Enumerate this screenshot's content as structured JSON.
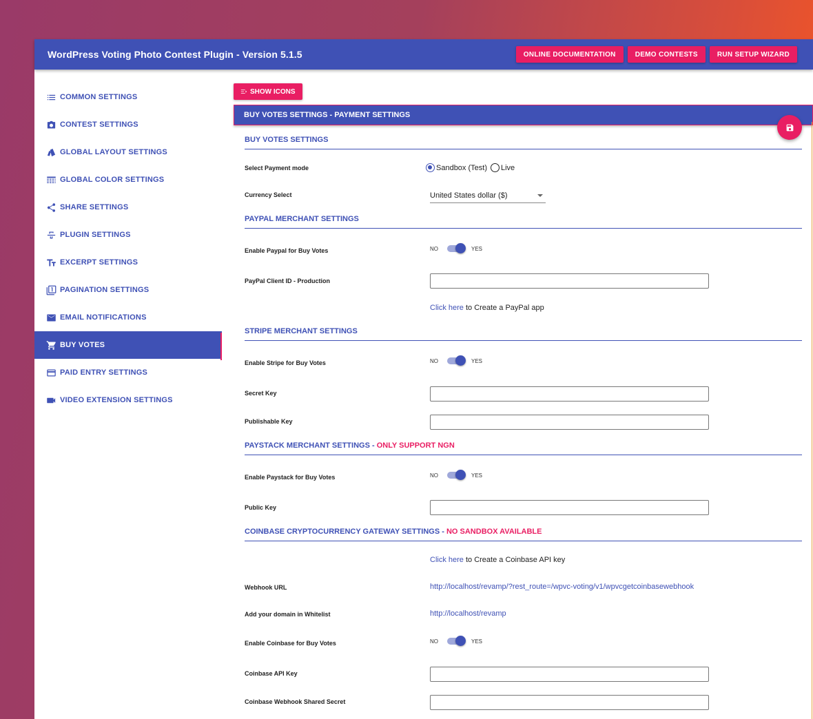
{
  "header": {
    "title": "WordPress Voting Photo Contest Plugin - Version 5.1.5",
    "buttons": [
      "ONLINE DOCUMENTATION",
      "DEMO CONTESTS",
      "RUN SETUP WIZARD"
    ]
  },
  "sidebar": {
    "items": [
      {
        "label": "COMMON SETTINGS",
        "icon": "list-icon"
      },
      {
        "label": "CONTEST SETTINGS",
        "icon": "camera-icon"
      },
      {
        "label": "GLOBAL LAYOUT SETTINGS",
        "icon": "layout-icon"
      },
      {
        "label": "GLOBAL COLOR SETTINGS",
        "icon": "color-grid-icon"
      },
      {
        "label": "SHARE SETTINGS",
        "icon": "share-icon"
      },
      {
        "label": "PLUGIN SETTINGS",
        "icon": "strikethrough-icon"
      },
      {
        "label": "EXCERPT SETTINGS",
        "icon": "text-fields-icon"
      },
      {
        "label": "PAGINATION SETTINGS",
        "icon": "filter-one-icon"
      },
      {
        "label": "EMAIL NOTIFICATIONS",
        "icon": "mail-icon"
      },
      {
        "label": "BUY VOTES",
        "icon": "cart-icon",
        "active": true
      },
      {
        "label": "PAID ENTRY SETTINGS",
        "icon": "card-icon"
      },
      {
        "label": "VIDEO EXTENSION SETTINGS",
        "icon": "video-icon"
      }
    ]
  },
  "main": {
    "show_icons": "SHOW ICONS",
    "banner": "BUY VOTES SETTINGS - PAYMENT SETTINGS",
    "buy_votes": {
      "title": "BUY VOTES SETTINGS",
      "payment_mode_label": "Select Payment mode",
      "sandbox": "Sandbox (Test)",
      "live": "Live",
      "currency_label": "Currency Select",
      "currency_value": "United States dollar ($)"
    },
    "paypal": {
      "title": "PAYPAL MERCHANT SETTINGS",
      "enable_label": "Enable Paypal for Buy Votes",
      "client_id_label": "PayPal Client ID - Production",
      "click_here": "Click here",
      "create_text": " to Create a PayPal app"
    },
    "stripe": {
      "title": "STRIPE MERCHANT SETTINGS",
      "enable_label": "Enable Stripe for Buy Votes",
      "secret_label": "Secret Key",
      "publishable_label": "Publishable Key"
    },
    "paystack": {
      "title": "PAYSTACK MERCHANT SETTINGS - ",
      "warning": "ONLY SUPPORT NGN",
      "enable_label": "Enable Paystack for Buy Votes",
      "public_key_label": "Public Key"
    },
    "coinbase": {
      "title": "COINBASE CRYPTOCURRENCY GATEWAY SETTINGS - ",
      "warning": "NO SANDBOX AVAILABLE",
      "click_here": "Click here",
      "create_text": " to Create a Coinbase API key",
      "webhook_label": "Webhook URL",
      "webhook_url": "http://localhost/revamp/?rest_route=/wpvc-voting/v1/wpvcgetcoinbasewebhook",
      "whitelist_label": "Add your domain in Whitelist",
      "whitelist_url": "http://localhost/revamp",
      "enable_label": "Enable Coinbase for Buy Votes",
      "api_key_label": "Coinbase API Key",
      "secret_label": "Coinbase Webhook Shared Secret"
    },
    "toggle": {
      "no": "NO",
      "yes": "YES"
    }
  },
  "colors": {
    "primary": "#3f51b5",
    "accent": "#e91e63"
  }
}
